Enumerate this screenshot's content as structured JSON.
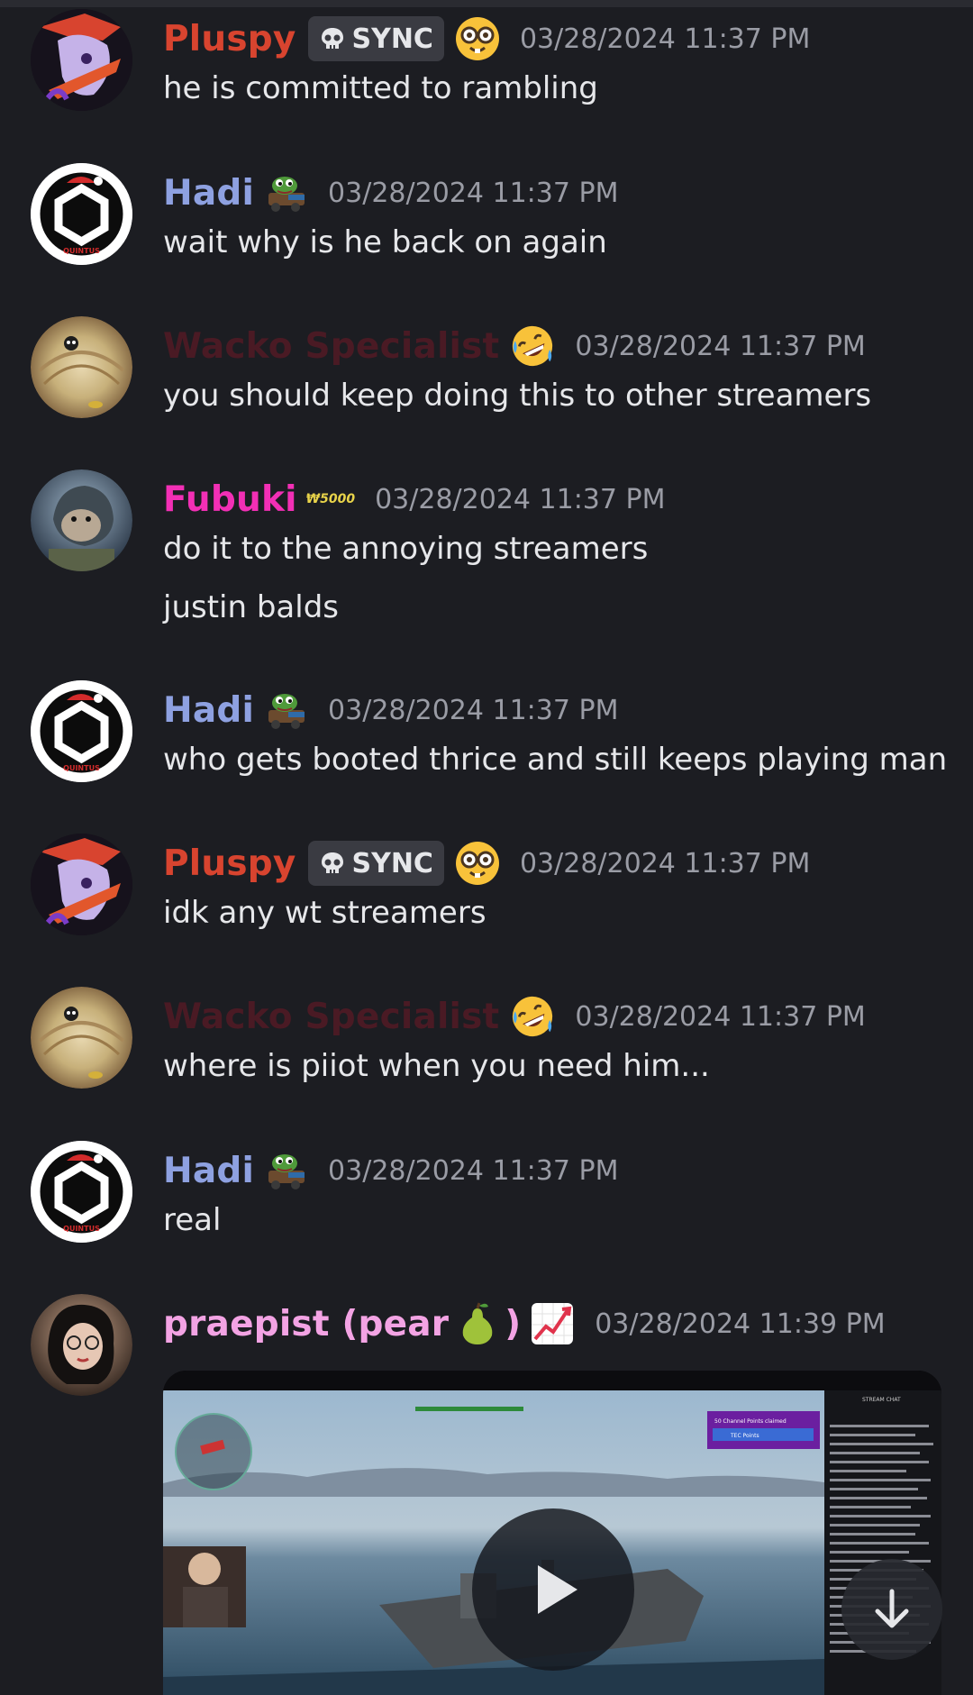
{
  "messages": [
    {
      "name": "Pluspy",
      "color": "#d8442f",
      "tag": "SYNC",
      "time": "03/28/2024 11:37 PM",
      "lines": [
        "he is committed to rambling"
      ]
    },
    {
      "name": "Hadi",
      "color": "#8ea1e1",
      "time": "03/28/2024 11:37 PM",
      "lines": [
        "wait why is he back on again"
      ]
    },
    {
      "name": "Wacko Specialist",
      "color": "#4a1a24",
      "time": "03/28/2024 11:37 PM",
      "lines": [
        "you should keep doing this to other streamers"
      ]
    },
    {
      "name": "Fubuki",
      "color": "#f22fb5",
      "badge": "₩5000",
      "time": "03/28/2024 11:37 PM",
      "lines": [
        "do it to the annoying streamers",
        "justin balds"
      ]
    },
    {
      "name": "Hadi",
      "color": "#8ea1e1",
      "time": "03/28/2024 11:37 PM",
      "lines": [
        "who gets booted thrice and still keeps playing man"
      ]
    },
    {
      "name": "Pluspy",
      "color": "#d8442f",
      "tag": "SYNC",
      "time": "03/28/2024 11:37 PM",
      "lines": [
        "idk any wt streamers"
      ]
    },
    {
      "name": "Wacko Specialist",
      "color": "#4a1a24",
      "time": "03/28/2024 11:37 PM",
      "lines": [
        "where is piiot when you need him..."
      ]
    },
    {
      "name": "Hadi",
      "color": "#8ea1e1",
      "time": "03/28/2024 11:37 PM",
      "lines": [
        "real"
      ]
    },
    {
      "name_a": "praepist (pear",
      "name_b": ")",
      "color": "#f3a3e4",
      "time": "03/28/2024 11:39 PM"
    }
  ],
  "icons": {
    "sync_tag": "skull-icon",
    "pluspy_emoji": "nerd-face-icon",
    "hadi_emoji": "pepe-tank-icon",
    "wacko_emoji": "rofl-icon",
    "pear_emoji": "pear-icon",
    "chart_emoji": "chart-increasing-icon",
    "play": "play-icon",
    "scroll": "arrow-down-icon"
  },
  "video_overlay": {
    "channel_points": "50 Channel Points claimed",
    "tec_points": "TEC Points",
    "stream_chat": "STREAM CHAT"
  }
}
